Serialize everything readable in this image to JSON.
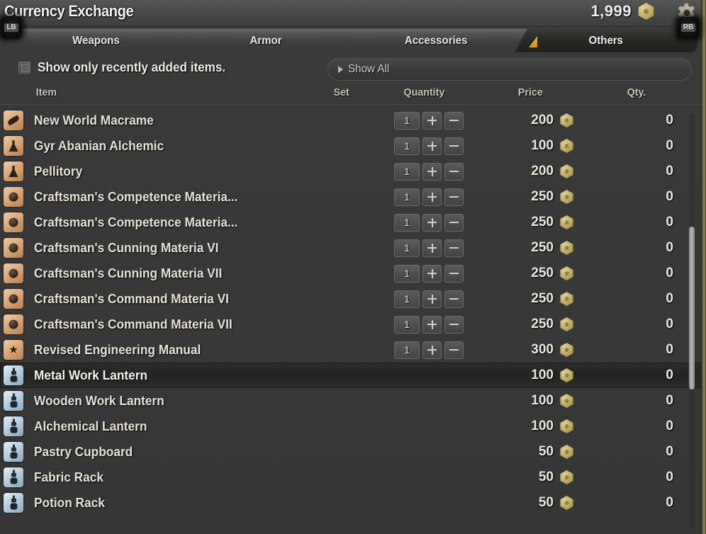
{
  "window": {
    "title": "Currency Exchange",
    "currency_amount": "1,999",
    "currency_icon": "hexagonal-gold-coin-icon",
    "settings_icon": "gear-icon",
    "shoulder_left": "LB",
    "shoulder_right": "RB"
  },
  "tabs": [
    {
      "label": "Weapons",
      "active": false
    },
    {
      "label": "Armor",
      "active": false
    },
    {
      "label": "Accessories",
      "active": false
    },
    {
      "label": "Others",
      "active": true
    }
  ],
  "filter": {
    "checkbox_label": "Show only recently added items.",
    "checkbox_checked": false,
    "show_all_label": "Show All"
  },
  "columns": {
    "item": "Item",
    "set": "Set",
    "quantity": "Quantity",
    "price": "Price",
    "qty": "Qty."
  },
  "colors": {
    "accent_gold": "#c98f19",
    "coin_gold": "#c0ad66",
    "text_primary": "#e6e2d6",
    "panel_bg": "#383838",
    "row_selected": "#262626"
  },
  "items": [
    {
      "name": "New World Macrame",
      "icon": "leaf-material-icon",
      "icon_theme": "tan",
      "quantity": "1",
      "has_stepper": true,
      "price": "200",
      "qty_owned": "0",
      "selected": false
    },
    {
      "name": "Gyr Abanian Alchemic",
      "icon": "flask-material-icon",
      "icon_theme": "tan",
      "quantity": "1",
      "has_stepper": true,
      "price": "100",
      "qty_owned": "0",
      "selected": false
    },
    {
      "name": "Pellitory",
      "icon": "flask-material-icon",
      "icon_theme": "tan",
      "quantity": "1",
      "has_stepper": true,
      "price": "200",
      "qty_owned": "0",
      "selected": false
    },
    {
      "name": "Craftsman's Competence Materia...",
      "icon": "materia-orb-icon",
      "icon_theme": "tan",
      "quantity": "1",
      "has_stepper": true,
      "price": "250",
      "qty_owned": "0",
      "selected": false
    },
    {
      "name": "Craftsman's Competence Materia...",
      "icon": "materia-orb-icon",
      "icon_theme": "tan",
      "quantity": "1",
      "has_stepper": true,
      "price": "250",
      "qty_owned": "0",
      "selected": false
    },
    {
      "name": "Craftsman's Cunning Materia VI",
      "icon": "materia-orb-icon",
      "icon_theme": "tan",
      "quantity": "1",
      "has_stepper": true,
      "price": "250",
      "qty_owned": "0",
      "selected": false
    },
    {
      "name": "Craftsman's Cunning Materia VII",
      "icon": "materia-orb-icon",
      "icon_theme": "tan",
      "quantity": "1",
      "has_stepper": true,
      "price": "250",
      "qty_owned": "0",
      "selected": false
    },
    {
      "name": "Craftsman's Command Materia VI",
      "icon": "materia-orb-icon",
      "icon_theme": "tan",
      "quantity": "1",
      "has_stepper": true,
      "price": "250",
      "qty_owned": "0",
      "selected": false
    },
    {
      "name": "Craftsman's Command Materia VII",
      "icon": "materia-orb-icon",
      "icon_theme": "tan",
      "quantity": "1",
      "has_stepper": true,
      "price": "250",
      "qty_owned": "0",
      "selected": false
    },
    {
      "name": "Revised Engineering Manual",
      "icon": "star-book-icon",
      "icon_theme": "tan",
      "quantity": "1",
      "has_stepper": true,
      "price": "300",
      "qty_owned": "0",
      "selected": false
    },
    {
      "name": "Metal Work Lantern",
      "icon": "lantern-furniture-icon",
      "icon_theme": "blue",
      "quantity": "",
      "has_stepper": false,
      "price": "100",
      "qty_owned": "0",
      "selected": true
    },
    {
      "name": "Wooden Work Lantern",
      "icon": "lantern-furniture-icon",
      "icon_theme": "blue",
      "quantity": "",
      "has_stepper": false,
      "price": "100",
      "qty_owned": "0",
      "selected": false
    },
    {
      "name": "Alchemical Lantern",
      "icon": "lantern-furniture-icon",
      "icon_theme": "blue",
      "quantity": "",
      "has_stepper": false,
      "price": "100",
      "qty_owned": "0",
      "selected": false
    },
    {
      "name": "Pastry Cupboard",
      "icon": "lantern-furniture-icon",
      "icon_theme": "blue",
      "quantity": "",
      "has_stepper": false,
      "price": "50",
      "qty_owned": "0",
      "selected": false
    },
    {
      "name": "Fabric Rack",
      "icon": "lantern-furniture-icon",
      "icon_theme": "blue",
      "quantity": "",
      "has_stepper": false,
      "price": "50",
      "qty_owned": "0",
      "selected": false
    },
    {
      "name": "Potion Rack",
      "icon": "lantern-furniture-icon",
      "icon_theme": "blue",
      "quantity": "",
      "has_stepper": false,
      "price": "50",
      "qty_owned": "0",
      "selected": false
    }
  ],
  "scrollbar": {
    "name": "vertical-scrollbar"
  }
}
